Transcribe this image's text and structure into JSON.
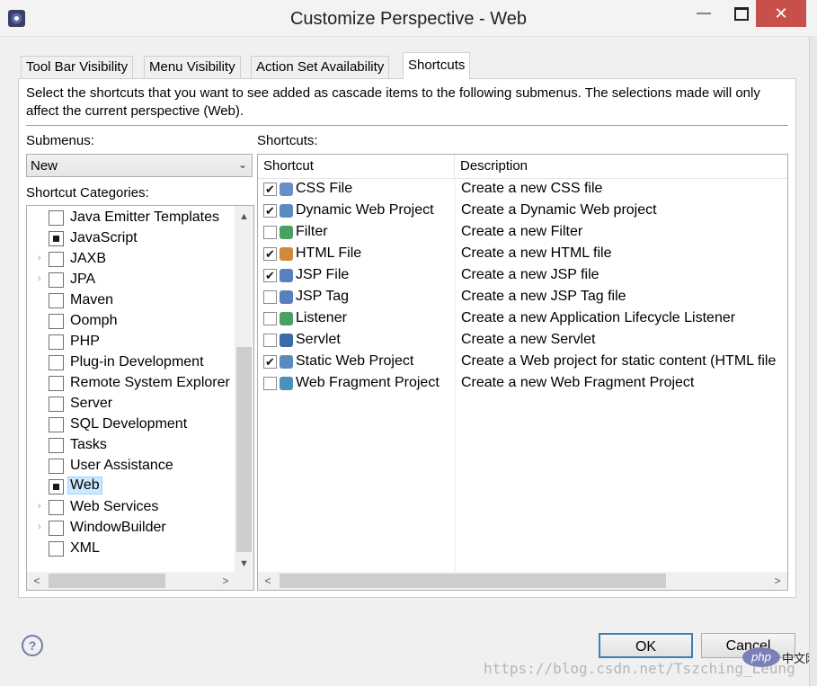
{
  "window": {
    "title": "Customize Perspective - Web",
    "minimize": "—",
    "close": "✕"
  },
  "tabs": [
    {
      "label": "Tool Bar Visibility"
    },
    {
      "label": "Menu Visibility"
    },
    {
      "label": "Action Set Availability"
    },
    {
      "label": "Shortcuts"
    }
  ],
  "description": "Select the shortcuts that you want to see added as cascade items to the following submenus.  The selections made will only affect the current perspective (Web).",
  "submenus": {
    "label": "Submenus:",
    "selected": "New"
  },
  "categories": {
    "label": "Shortcut Categories:",
    "items": [
      {
        "name": "Java Emitter Templates",
        "state": "unchecked",
        "expandable": false
      },
      {
        "name": "JavaScript",
        "state": "partial",
        "expandable": false
      },
      {
        "name": "JAXB",
        "state": "unchecked",
        "expandable": true
      },
      {
        "name": "JPA",
        "state": "unchecked",
        "expandable": true
      },
      {
        "name": "Maven",
        "state": "unchecked",
        "expandable": false
      },
      {
        "name": "Oomph",
        "state": "unchecked",
        "expandable": false
      },
      {
        "name": "PHP",
        "state": "unchecked",
        "expandable": false
      },
      {
        "name": "Plug-in Development",
        "state": "unchecked",
        "expandable": false
      },
      {
        "name": "Remote System Explorer",
        "state": "unchecked",
        "expandable": false
      },
      {
        "name": "Server",
        "state": "unchecked",
        "expandable": false
      },
      {
        "name": "SQL Development",
        "state": "unchecked",
        "expandable": false
      },
      {
        "name": "Tasks",
        "state": "unchecked",
        "expandable": false
      },
      {
        "name": "User Assistance",
        "state": "unchecked",
        "expandable": false
      },
      {
        "name": "Web",
        "state": "partial",
        "expandable": false,
        "selected": true
      },
      {
        "name": "Web Services",
        "state": "unchecked",
        "expandable": true
      },
      {
        "name": "WindowBuilder",
        "state": "unchecked",
        "expandable": true
      },
      {
        "name": "XML",
        "state": "unchecked",
        "expandable": false
      }
    ]
  },
  "shortcuts": {
    "label": "Shortcuts:",
    "columns": [
      "Shortcut",
      "Description"
    ],
    "rows": [
      {
        "name": "CSS File",
        "desc": "Create a new CSS file",
        "checked": true,
        "icon": "css-file-icon",
        "color": "#6a8fc8"
      },
      {
        "name": "Dynamic Web Project",
        "desc": "Create a Dynamic Web project",
        "checked": true,
        "icon": "web-project-icon",
        "color": "#5a8ac0"
      },
      {
        "name": "Filter",
        "desc": "Create a new Filter",
        "checked": false,
        "icon": "filter-icon",
        "color": "#4aa060"
      },
      {
        "name": "HTML File",
        "desc": "Create a new HTML file",
        "checked": true,
        "icon": "html-file-icon",
        "color": "#d08a3a"
      },
      {
        "name": "JSP File",
        "desc": "Create a new JSP file",
        "checked": true,
        "icon": "jsp-file-icon",
        "color": "#5a7fc0"
      },
      {
        "name": "JSP Tag",
        "desc": "Create a new JSP Tag file",
        "checked": false,
        "icon": "jsp-tag-icon",
        "color": "#5a7fc0"
      },
      {
        "name": "Listener",
        "desc": "Create a new Application Lifecycle Listener",
        "checked": false,
        "icon": "listener-icon",
        "color": "#4aa060"
      },
      {
        "name": "Servlet",
        "desc": "Create a new Servlet",
        "checked": false,
        "icon": "servlet-icon",
        "color": "#3a6aa8"
      },
      {
        "name": "Static Web Project",
        "desc": "Create a Web project for static content (HTML file",
        "checked": true,
        "icon": "static-web-project-icon",
        "color": "#5a8ac0"
      },
      {
        "name": "Web Fragment Project",
        "desc": "Create a new Web Fragment Project",
        "checked": false,
        "icon": "web-fragment-project-icon",
        "color": "#4a90b8"
      }
    ]
  },
  "buttons": {
    "ok": "OK",
    "cancel": "Cancel",
    "help": "?"
  },
  "watermark": "https://blog.csdn.net/Tszching_Leung",
  "php_badge": {
    "logo": "php",
    "text": "中文网"
  }
}
